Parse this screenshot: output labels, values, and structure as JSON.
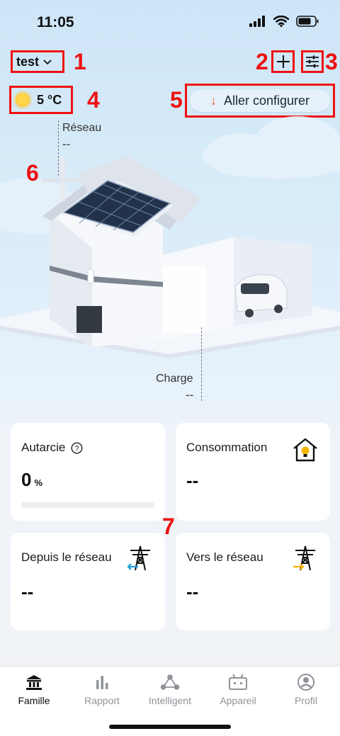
{
  "status": {
    "time": "11:05"
  },
  "header": {
    "site_name": "test",
    "weather": {
      "temperature": "5 °C",
      "icon": "sun-icon"
    },
    "config_button_label": "Aller configurer"
  },
  "annotations": [
    "1",
    "2",
    "3",
    "4",
    "5",
    "6",
    "7"
  ],
  "scene": {
    "grid_label": "Réseau",
    "grid_value": "--",
    "charge_label": "Charge",
    "charge_value": "--"
  },
  "cards": {
    "autarky": {
      "title": "Autarcie",
      "value": "0",
      "unit": "%",
      "progress": 0
    },
    "consumption": {
      "title": "Consommation",
      "value": "--",
      "icon": "house-bulb-icon"
    },
    "from_grid": {
      "title": "Depuis le réseau",
      "value": "--",
      "icon": "pylon-import-icon"
    },
    "to_grid": {
      "title": "Vers le réseau",
      "value": "--",
      "icon": "pylon-export-icon"
    }
  },
  "nav": {
    "items": [
      {
        "label": "Famille",
        "icon": "home-icon",
        "active": true
      },
      {
        "label": "Rapport",
        "icon": "bar-chart-icon",
        "active": false
      },
      {
        "label": "Intelligent",
        "icon": "network-icon",
        "active": false
      },
      {
        "label": "Appareil",
        "icon": "device-icon",
        "active": false
      },
      {
        "label": "Profil",
        "icon": "profile-icon",
        "active": false
      }
    ]
  },
  "colors": {
    "accent_red": "#e11111",
    "arrow_orange": "#f15a2b",
    "import_blue": "#1aa0e0",
    "export_yellow": "#f5b400"
  }
}
